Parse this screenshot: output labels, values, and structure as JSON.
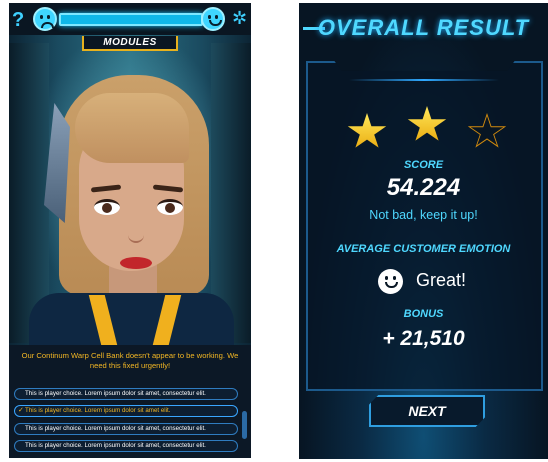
{
  "left_screen": {
    "help_icon_glyph": "?",
    "settings_icon_glyph": "✲",
    "meter_color": "#19c9ff",
    "tab_label": "MODULES",
    "prompt": "Our Continum Warp Cell Bank doesn't appear to be working. We need this fixed urgently!",
    "choices": [
      {
        "text": "This is player choice. Lorem ipsum dolor sit amet, consectetur elit.",
        "selected": false
      },
      {
        "text": "This is player choice. Lorem ipsum dolor sit amet elit.",
        "selected": true
      },
      {
        "text": "This is player choice. Lorem ipsum dolor sit amet, consectetur elit.",
        "selected": false
      },
      {
        "text": "This is player choice. Lorem ipsum dolor sit amet, consectetur elit.",
        "selected": false
      }
    ],
    "check_glyph": "✓"
  },
  "right_screen": {
    "title": "OVERALL RESULT",
    "stars": {
      "earned": 2,
      "total": 3
    },
    "score_label": "SCORE",
    "score_value": "54.224",
    "comment": "Not bad, keep it up!",
    "emotion_label": "AVERAGE CUSTOMER EMOTION",
    "emotion_value": "Great!",
    "bonus_label": "BONUS",
    "bonus_value": "+ 21,510",
    "next_label": "NEXT"
  },
  "colors": {
    "accent_cyan": "#4fd8ff",
    "accent_gold": "#f2b624",
    "star_gold": "#ffd23a"
  }
}
